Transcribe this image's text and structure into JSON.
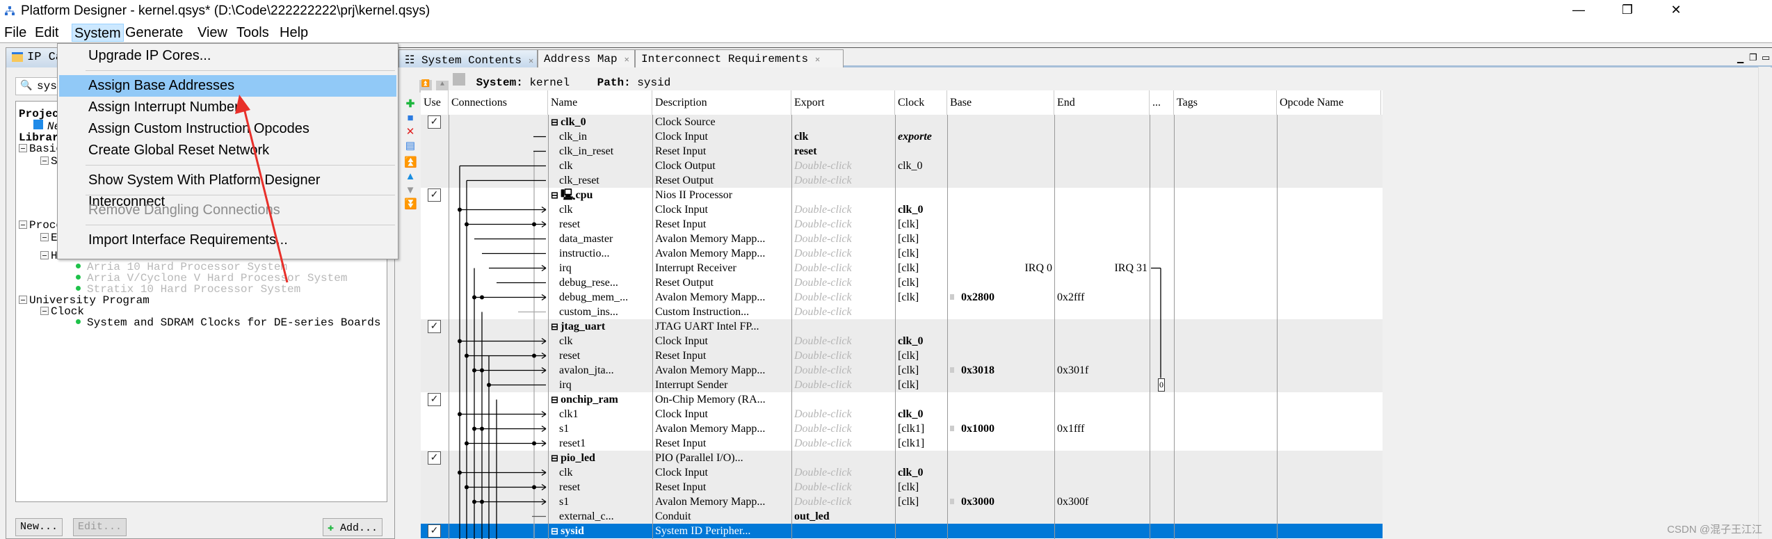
{
  "window": {
    "title": "Platform Designer - kernel.qsys* (D:\\Code\\222222222\\prj\\kernel.qsys)",
    "minimize": "—",
    "restore": "❐",
    "close": "✕"
  },
  "menubar": [
    {
      "label": "File"
    },
    {
      "label": "Edit"
    },
    {
      "label": "System",
      "active": true
    },
    {
      "label": "Generate"
    },
    {
      "label": "View"
    },
    {
      "label": "Tools"
    },
    {
      "label": "Help"
    }
  ],
  "system_menu": {
    "items": [
      {
        "label": "Upgrade IP Cores..."
      },
      {
        "sep": true
      },
      {
        "label": "Assign Base Addresses",
        "highlighted": true
      },
      {
        "label": "Assign Interrupt Numbers"
      },
      {
        "label": "Assign Custom Instruction Opcodes"
      },
      {
        "label": "Create Global Reset Network"
      },
      {
        "sep": true
      },
      {
        "label": "Show System With Platform Designer Interconnect"
      },
      {
        "sep": true
      },
      {
        "label": "Remove Dangling Connections",
        "disabled": true
      },
      {
        "sep": true
      },
      {
        "label": "Import Interface Requirements..."
      }
    ]
  },
  "ip_catalog": {
    "tab_label": "IP Ca",
    "search_value": "sys",
    "tree": [
      {
        "label": "Projec",
        "bold": true,
        "level": 0
      },
      {
        "label": "Ne",
        "italic": true,
        "level": 1,
        "icon": true
      },
      {
        "label": "Librar",
        "bold": true,
        "level": 0
      },
      {
        "label": "Basic",
        "level": 0,
        "expander": true
      },
      {
        "label": "Si",
        "level": 1,
        "expander": true
      },
      {
        "label": "",
        "level": 2,
        "expander": true
      },
      {
        "label": "Proce",
        "level": 0,
        "expander": true,
        "gap": true
      },
      {
        "label": "Em",
        "level": 1,
        "expander": true
      },
      {
        "label": "Ha",
        "level": 1,
        "expander": true
      },
      {
        "label": "Arria 10 Hard Processor System",
        "level": 2,
        "dim": true,
        "bullet": true
      },
      {
        "label": "Arria V/Cyclone V Hard Processor System",
        "level": 2,
        "dim": true,
        "bullet": true
      },
      {
        "label": "Stratix 10 Hard Processor System",
        "level": 2,
        "dim": true,
        "bullet": true
      },
      {
        "label": "University Program",
        "level": 0,
        "expander": true
      },
      {
        "label": "Clock",
        "level": 1,
        "expander": true
      },
      {
        "label": "System and SDRAM Clocks for DE-series Boards",
        "level": 2,
        "bullet": true
      }
    ],
    "buttons": {
      "new": "New...",
      "edit": "Edit...",
      "add": "Add..."
    }
  },
  "tabs": [
    {
      "label": "System Contents",
      "selected": true
    },
    {
      "label": "Address Map"
    },
    {
      "label": "Interconnect Requirements"
    }
  ],
  "path_bar": {
    "system_label": "System:",
    "system_value": "kernel",
    "path_label": "Path:",
    "path_value": "sysid"
  },
  "columns": [
    "Use",
    "Connections",
    "Name",
    "Description",
    "Export",
    "Clock",
    "Base",
    "End",
    "...",
    "Tags",
    "Opcode Name"
  ],
  "rows": [
    {
      "g": "g",
      "use": true,
      "name": "clk_0",
      "header": true,
      "desc": "Clock Source"
    },
    {
      "g": "g",
      "name": "clk_in",
      "desc": "Clock Input",
      "export": "clk",
      "export_style": "b",
      "clock": "exporte",
      "clock_style": "bi",
      "port": "in-ext"
    },
    {
      "g": "g",
      "name": "clk_in_reset",
      "desc": "Reset Input",
      "export": "reset",
      "export_style": "b",
      "port": "in-ext"
    },
    {
      "g": "g",
      "name": "clk",
      "desc": "Clock Output",
      "export": "Double-click",
      "export_style": "hint",
      "clock": "clk_0",
      "port": "out-clk"
    },
    {
      "g": "g",
      "name": "clk_reset",
      "desc": "Reset Output",
      "export": "Double-click",
      "export_style": "hint",
      "port": "out-rst"
    },
    {
      "g": "w",
      "use": true,
      "name": "cpu",
      "header": true,
      "cpu_icon": true,
      "desc": "Nios II Processor"
    },
    {
      "g": "w",
      "name": "clk",
      "desc": "Clock Input",
      "export": "Double-click",
      "export_style": "hint",
      "clock": "clk_0",
      "clock_style": "b",
      "port": "clk"
    },
    {
      "g": "w",
      "name": "reset",
      "desc": "Reset Input",
      "export": "Double-click",
      "export_style": "hint",
      "clock": "[clk]",
      "port": "rst"
    },
    {
      "g": "w",
      "name": "data_master",
      "desc": "Avalon Memory Mapp...",
      "export": "Double-click",
      "export_style": "hint",
      "clock": "[clk]",
      "port": "dm"
    },
    {
      "g": "w",
      "name": "instructio...",
      "desc": "Avalon Memory Mapp...",
      "export": "Double-click",
      "export_style": "hint",
      "clock": "[clk]",
      "port": "im"
    },
    {
      "g": "w",
      "name": "irq",
      "desc": "Interrupt Receiver",
      "export": "Double-click",
      "export_style": "hint",
      "clock": "[clk]",
      "irq_lo": "IRQ 0",
      "irq_hi": "IRQ 31",
      "port": "irqr"
    },
    {
      "g": "w",
      "name": "debug_rese...",
      "desc": "Reset Output",
      "export": "Double-click",
      "export_style": "hint",
      "clock": "[clk]",
      "port": "dro"
    },
    {
      "g": "w",
      "name": "debug_mem_...",
      "desc": "Avalon Memory Mapp...",
      "export": "Double-click",
      "export_style": "hint",
      "clock": "[clk]",
      "base": "0x2800",
      "end": "0x2fff",
      "port": "slave"
    },
    {
      "g": "w",
      "name": "custom_ins...",
      "desc": "Custom Instruction...",
      "export": "Double-click",
      "export_style": "hint",
      "port": "ci"
    },
    {
      "g": "g",
      "use": true,
      "name": "jtag_uart",
      "header": true,
      "desc": "JTAG UART Intel FP..."
    },
    {
      "g": "g",
      "name": "clk",
      "desc": "Clock Input",
      "export": "Double-click",
      "export_style": "hint",
      "clock": "clk_0",
      "clock_style": "b",
      "port": "clk"
    },
    {
      "g": "g",
      "name": "reset",
      "desc": "Reset Input",
      "export": "Double-click",
      "export_style": "hint",
      "clock": "[clk]",
      "port": "rst"
    },
    {
      "g": "g",
      "name": "avalon_jta...",
      "desc": "Avalon Memory Mapp...",
      "export": "Double-click",
      "export_style": "hint",
      "clock": "[clk]",
      "base": "0x3018",
      "end": "0x301f",
      "port": "slave"
    },
    {
      "g": "g",
      "name": "irq",
      "desc": "Interrupt Sender",
      "export": "Double-click",
      "export_style": "hint",
      "clock": "[clk]",
      "irq_num": "0",
      "port": "irqs"
    },
    {
      "g": "w",
      "use": true,
      "name": "onchip_ram",
      "header": true,
      "desc": "On-Chip Memory (RA..."
    },
    {
      "g": "w",
      "name": "clk1",
      "desc": "Clock Input",
      "export": "Double-click",
      "export_style": "hint",
      "clock": "clk_0",
      "clock_style": "b",
      "port": "clk"
    },
    {
      "g": "w",
      "name": "s1",
      "desc": "Avalon Memory Mapp...",
      "export": "Double-click",
      "export_style": "hint",
      "clock": "[clk1]",
      "base": "0x1000",
      "end": "0x1fff",
      "port": "slave2"
    },
    {
      "g": "w",
      "name": "reset1",
      "desc": "Reset Input",
      "export": "Double-click",
      "export_style": "hint",
      "clock": "[clk1]",
      "port": "rst"
    },
    {
      "g": "g",
      "use": true,
      "name": "pio_led",
      "header": true,
      "desc": "PIO (Parallel I/O)..."
    },
    {
      "g": "g",
      "name": "clk",
      "desc": "Clock Input",
      "export": "Double-click",
      "export_style": "hint",
      "clock": "clk_0",
      "clock_style": "b",
      "port": "clk"
    },
    {
      "g": "g",
      "name": "reset",
      "desc": "Reset Input",
      "export": "Double-click",
      "export_style": "hint",
      "clock": "[clk]",
      "port": "rst"
    },
    {
      "g": "g",
      "name": "s1",
      "desc": "Avalon Memory Mapp...",
      "export": "Double-click",
      "export_style": "hint",
      "clock": "[clk]",
      "base": "0x3000",
      "end": "0x300f",
      "port": "slave"
    },
    {
      "g": "g",
      "name": "external_c...",
      "desc": "Conduit",
      "export": "out_led",
      "export_style": "b",
      "port": "conduit"
    },
    {
      "g": "s",
      "use": true,
      "name": "sysid",
      "header": true,
      "desc": "System ID Peripher..."
    }
  ],
  "colors": {
    "selected_row": "#0078d7",
    "menu_highlight": "#91c9f7",
    "annotation_arrow": "#e8302a"
  },
  "watermark": "CSDN @混子王江江"
}
